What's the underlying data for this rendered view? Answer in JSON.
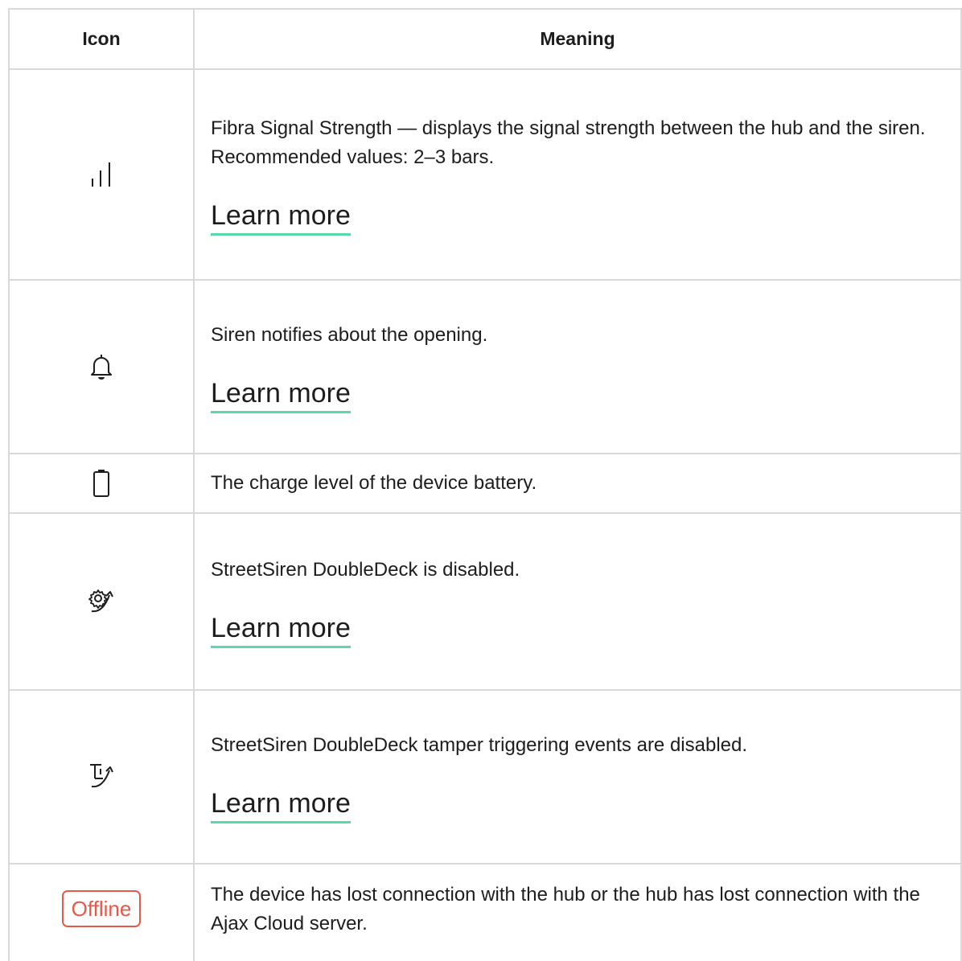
{
  "table": {
    "headers": {
      "icon": "Icon",
      "meaning": "Meaning"
    },
    "rows": [
      {
        "icon": "signal-strength-icon",
        "description": "Fibra Signal Strength — displays the signal strength between the hub and the siren. Recommended values: 2–3 bars.",
        "link": "Learn more"
      },
      {
        "icon": "bell-icon",
        "description": "Siren notifies about the opening.",
        "link": "Learn more"
      },
      {
        "icon": "battery-icon",
        "description": "The charge level of the device battery."
      },
      {
        "icon": "gear-disabled-icon",
        "description": "StreetSiren DoubleDeck is disabled.",
        "link": "Learn more"
      },
      {
        "icon": "tamper-disabled-icon",
        "description": "StreetSiren DoubleDeck tamper triggering events are disabled.",
        "link": "Learn more"
      },
      {
        "icon": "offline-badge",
        "badge": "Offline",
        "description": "The device has lost connection with the hub or the hub has lost connection with the Ajax Cloud server."
      }
    ]
  },
  "colors": {
    "border": "#d9d9d9",
    "link_underline": "#5ad9a8",
    "offline": "#e5594a",
    "text": "#1d1d1d"
  }
}
